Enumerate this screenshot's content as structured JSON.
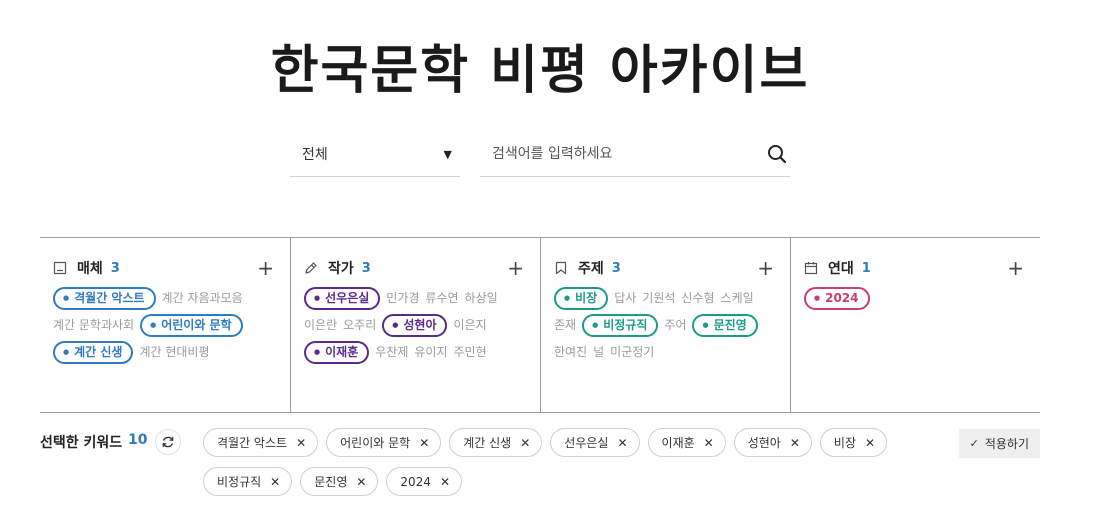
{
  "header": {
    "title": "한국문학 비평 아카이브"
  },
  "search": {
    "scope": "전체",
    "placeholder": "검색어를 입력하세요",
    "value": ""
  },
  "filters": [
    {
      "name": "매체",
      "count": "3",
      "icon": "book-icon",
      "keywords": [
        {
          "label": "격월간 악스트",
          "selected": true,
          "color": "#4a90d9"
        },
        {
          "label": "계간 자음과모음",
          "selected": false
        },
        {
          "label": "계간 문학과사회",
          "selected": false
        },
        {
          "label": "어린이와 문학",
          "selected": true,
          "color": "#4a90d9"
        },
        {
          "label": "계간 신생",
          "selected": true,
          "color": "#4a90d9"
        },
        {
          "label": "계간 현대비평",
          "selected": false
        }
      ]
    },
    {
      "name": "작가",
      "count": "3",
      "icon": "pen-icon",
      "keywords": [
        {
          "label": "선우은실",
          "selected": true,
          "color": "#6a2c91"
        },
        {
          "label": "민가경",
          "selected": false
        },
        {
          "label": "류수연",
          "selected": false
        },
        {
          "label": "하상일",
          "selected": false
        },
        {
          "label": "이은란",
          "selected": false
        },
        {
          "label": "오주리",
          "selected": false
        },
        {
          "label": "성현아",
          "selected": true,
          "color": "#6a2c91"
        },
        {
          "label": "이은지",
          "selected": false
        },
        {
          "label": "이재훈",
          "selected": true,
          "color": "#6a2c91"
        },
        {
          "label": "우찬제",
          "selected": false
        },
        {
          "label": "유이지",
          "selected": false
        },
        {
          "label": "주민현",
          "selected": false
        }
      ]
    },
    {
      "name": "주제",
      "count": "3",
      "icon": "bookmark-icon",
      "keywords": [
        {
          "label": "비장",
          "selected": true,
          "color": "#2bab97"
        },
        {
          "label": "답사",
          "selected": false
        },
        {
          "label": "기원석",
          "selected": false
        },
        {
          "label": "신수형",
          "selected": false
        },
        {
          "label": "스케일",
          "selected": false
        },
        {
          "label": "존재",
          "selected": false
        },
        {
          "label": "비정규직",
          "selected": true,
          "color": "#2bab97"
        },
        {
          "label": "주어",
          "selected": false
        },
        {
          "label": "문진영",
          "selected": true,
          "color": "#2bab97"
        },
        {
          "label": "한여진",
          "selected": false
        },
        {
          "label": "널",
          "selected": false
        },
        {
          "label": "미군정기",
          "selected": false
        }
      ]
    },
    {
      "name": "연대",
      "count": "1",
      "icon": "calendar-icon",
      "keywords": [
        {
          "label": "2024",
          "selected": true,
          "color": "#d4507a"
        }
      ]
    }
  ],
  "selected_keywords": {
    "label": "선택한 키워드",
    "count": "10",
    "items": [
      "격월간 악스트",
      "어린이와 문학",
      "계간 신생",
      "선우은실",
      "이재훈",
      "성현아",
      "비장",
      "비정규직",
      "문진영",
      "2024"
    ],
    "remove_glyph": "✕"
  },
  "apply_button": {
    "label": "적용하기",
    "icon": "check-icon"
  }
}
